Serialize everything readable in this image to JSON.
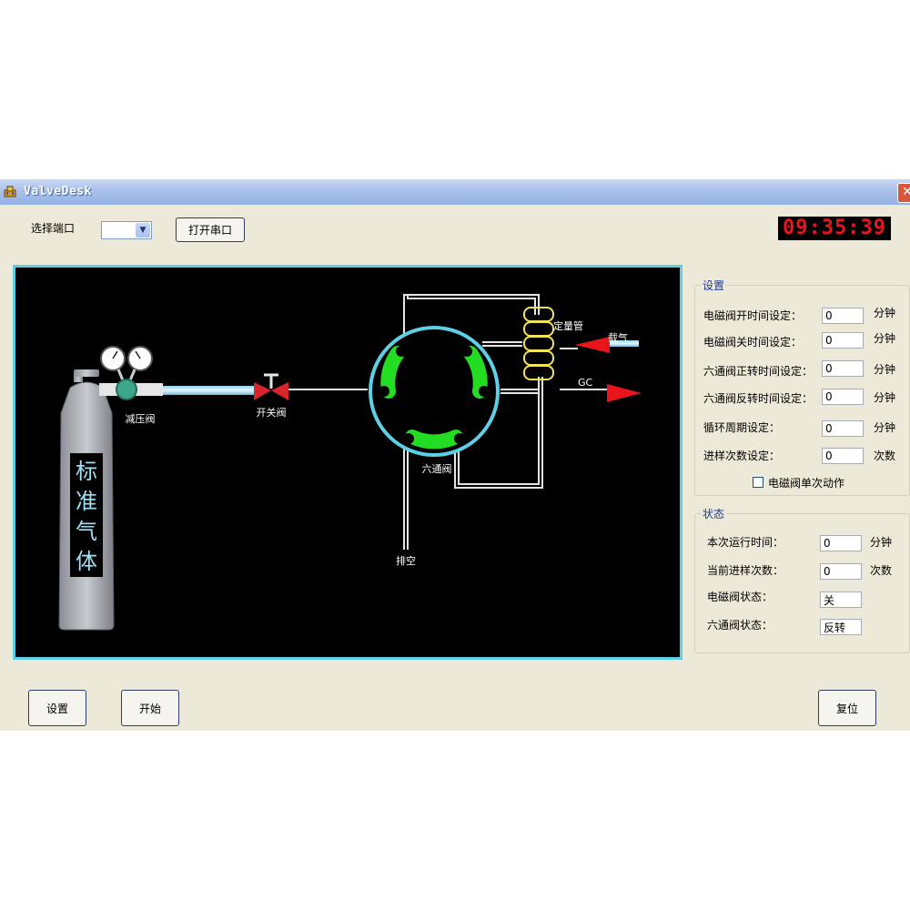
{
  "window": {
    "title": "ValveDesk",
    "close_symbol": "✕"
  },
  "toolbar": {
    "port_label": "选择端口",
    "port_selected": "",
    "open_port_button": "打开串口",
    "led_display": "09:35:39"
  },
  "diagram": {
    "cylinder_text": [
      "标",
      "准",
      "气",
      "体"
    ],
    "regulator_label": "减压阀",
    "switch_valve_label": "开关阀",
    "six_port_valve_label": "六通阀",
    "loop_label": "定量管",
    "carrier_gas_label": "载气",
    "gc_label": "GC",
    "vent_label": "排空",
    "colors": {
      "background": "#000000",
      "pipe": "#e6e6e6",
      "valve_ring": "#5ed0e6",
      "rotor_green": "#22dd22",
      "arrow_red": "#e8161c",
      "loop_yellow": "#f2e45a",
      "valve_red": "#d6262a"
    }
  },
  "settings": {
    "group_title": "设置",
    "rows": [
      {
        "label": "电磁阀开时间设定：",
        "value": "0",
        "unit": "分钟"
      },
      {
        "label": "电磁阀关时间设定：",
        "value": "0",
        "unit": "分钟"
      },
      {
        "label": "六通阀正转时间设定：",
        "value": "0",
        "unit": "分钟"
      },
      {
        "label": "六通阀反转时间设定：",
        "value": "0",
        "unit": "分钟"
      },
      {
        "label": "循环周期设定：",
        "value": "0",
        "unit": "分钟"
      },
      {
        "label": "进样次数设定：",
        "value": "0",
        "unit": "次数"
      }
    ],
    "single_action_checkbox": "电磁阀单次动作",
    "single_action_checked": false
  },
  "status": {
    "group_title": "状态",
    "rows": [
      {
        "label": "本次运行时间：",
        "value": "0",
        "unit": "分钟"
      },
      {
        "label": "当前进样次数：",
        "value": "0",
        "unit": "次数"
      },
      {
        "label": "电磁阀状态：",
        "value": "关",
        "unit": ""
      },
      {
        "label": "六通阀状态：",
        "value": "反转",
        "unit": ""
      }
    ]
  },
  "footer": {
    "settings_button": "设置",
    "start_button": "开始",
    "reset_button": "复位"
  }
}
